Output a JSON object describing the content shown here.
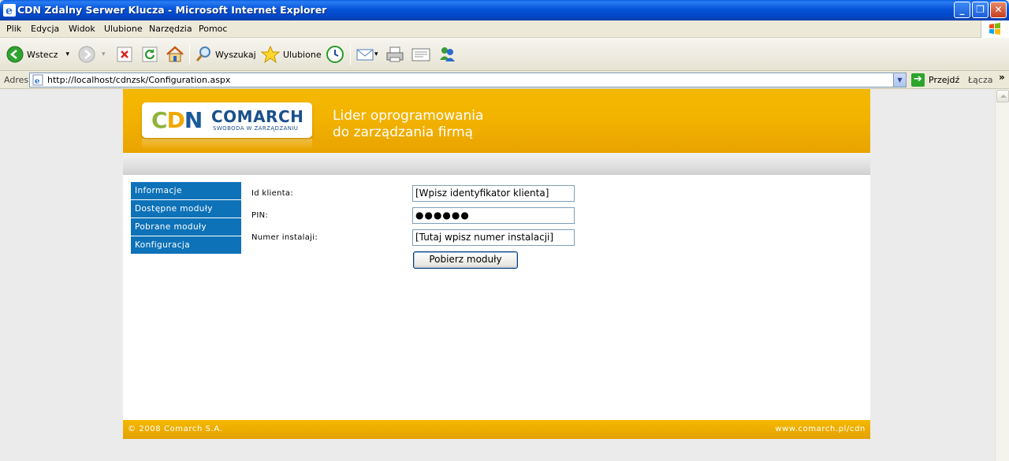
{
  "window": {
    "title": "CDN Zdalny Serwer Klucza - Microsoft Internet Explorer",
    "min_symbol": "_",
    "max_symbol": "❐",
    "close_symbol": "✕"
  },
  "menubar": [
    "Plik",
    "Edycja",
    "Widok",
    "Ulubione",
    "Narzędzia",
    "Pomoc"
  ],
  "toolbar": {
    "back_label": "Wstecz",
    "search_label": "Wyszukaj",
    "favorites_label": "Ulubione",
    "dropdown_symbol": "▾"
  },
  "address": {
    "label": "Adres",
    "url": "http://localhost/cdnzsk/Configuration.aspx",
    "go_label": "Przejdź",
    "go_symbol": "➔",
    "links_label": "Łącza",
    "chevron": "»",
    "dropdown_symbol": "▼"
  },
  "banner": {
    "logo_cdn": [
      "C",
      "D",
      "N"
    ],
    "logo_comarch": "COMARCH",
    "logo_motto": "SWOBODA W ZARZĄDZANIU",
    "slogan_line1": "Lider oprogramowania",
    "slogan_line2": "do zarządzania firmą"
  },
  "side_menu": [
    "Informacje",
    "Dostępne moduły",
    "Pobrane moduły",
    "Konfiguracja"
  ],
  "form": {
    "client_id_label": "Id klienta:",
    "client_id_value": "[Wpisz identyfikator klienta]",
    "pin_label": "PIN:",
    "pin_value": "●●●●●●",
    "install_label": "Numer instalaji:",
    "install_value": "[Tutaj wpisz numer instalacji]",
    "submit_label": "Pobierz moduły"
  },
  "footer": {
    "copyright": "© 2008 Comarch S.A.",
    "site": "www.comarch.pl/cdn"
  },
  "colors": {
    "title_bar": "#0553d8",
    "banner": "#f3b300",
    "menu_item": "#0e72b8",
    "logo_blue": "#1a4f8c",
    "logo_green": "#8fb43b"
  }
}
